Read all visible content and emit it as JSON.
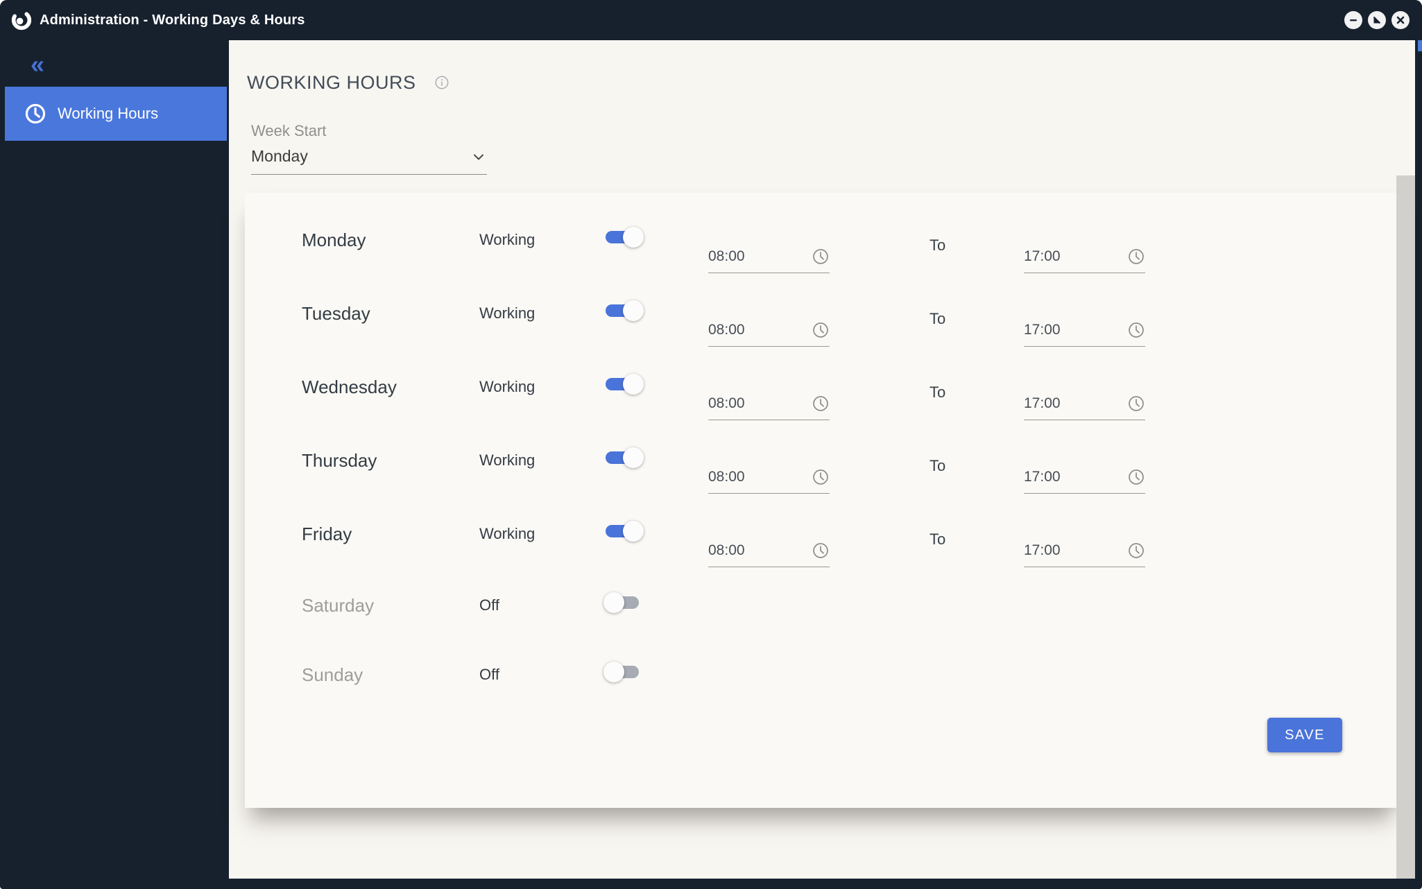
{
  "window": {
    "title": "Administration - Working Days & Hours",
    "controls": {
      "minimize": "minimize-icon",
      "maximize": "maximize-icon",
      "close": "close-icon"
    }
  },
  "sidebar": {
    "collapse_glyph": "«",
    "items": [
      {
        "label": "Working Hours",
        "icon": "clock-icon",
        "active": true
      }
    ]
  },
  "main": {
    "heading": "WORKING HOURS",
    "info_icon": "info-icon",
    "week_start": {
      "label": "Week Start",
      "value": "Monday"
    },
    "days": [
      {
        "name": "Monday",
        "status": "Working",
        "enabled": true,
        "from": "08:00",
        "to_label": "To",
        "to": "17:00"
      },
      {
        "name": "Tuesday",
        "status": "Working",
        "enabled": true,
        "from": "08:00",
        "to_label": "To",
        "to": "17:00"
      },
      {
        "name": "Wednesday",
        "status": "Working",
        "enabled": true,
        "from": "08:00",
        "to_label": "To",
        "to": "17:00"
      },
      {
        "name": "Thursday",
        "status": "Working",
        "enabled": true,
        "from": "08:00",
        "to_label": "To",
        "to": "17:00"
      },
      {
        "name": "Friday",
        "status": "Working",
        "enabled": true,
        "from": "08:00",
        "to_label": "To",
        "to": "17:00"
      },
      {
        "name": "Saturday",
        "status": "Off",
        "enabled": false
      },
      {
        "name": "Sunday",
        "status": "Off",
        "enabled": false
      }
    ],
    "save_label": "SAVE"
  },
  "colors": {
    "titlebar_bg": "#17212e",
    "sidebar_bg": "#17212e",
    "active_item_bg": "#4a77dc",
    "accent_blue": "#4a74d9",
    "toggle_off_gray": "#a6abb4",
    "page_bg": "#f8f6f1",
    "card_bg": "#fbf9f5",
    "heading_text": "#414c57",
    "muted_text": "#8f8f8f",
    "disabled_day_text": "#9d9d9d"
  }
}
